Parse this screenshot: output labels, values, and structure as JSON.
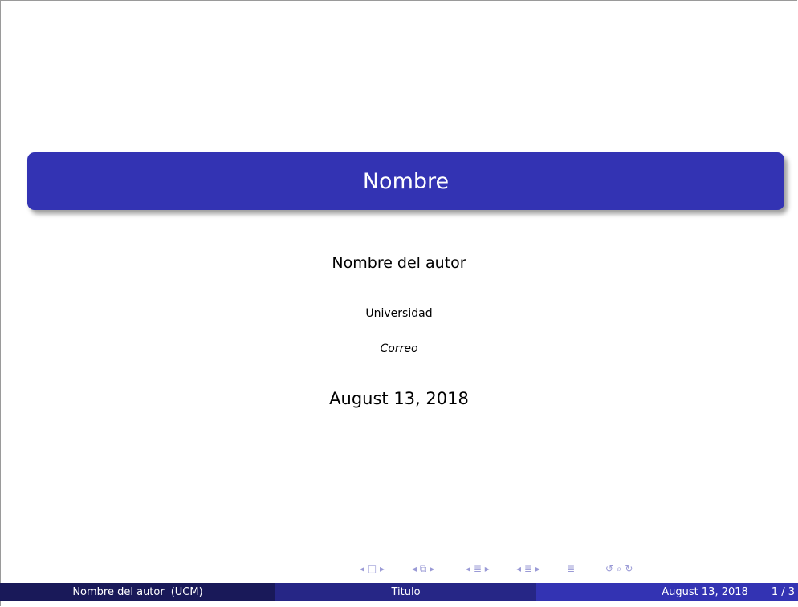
{
  "slide": {
    "title": "Nombre",
    "author": "Nombre del autor",
    "institute": "Universidad",
    "email": "Correo",
    "date": "August 13, 2018"
  },
  "footer": {
    "author": "Nombre del autor",
    "institute_short": "(UCM)",
    "title": "Titulo",
    "date": "August 13, 2018",
    "page": "1 / 3"
  },
  "colors": {
    "title_box": "#3333b3",
    "footer_left": "#191959",
    "footer_middle": "#262686",
    "footer_right": "#3333b3",
    "nav_symbols": "#9a9ad6"
  },
  "nav_icons": [
    "nav-frame-icon",
    "nav-subsection-icon",
    "nav-section-icon",
    "nav-section-icon",
    "nav-align-icon",
    "nav-search-icon"
  ]
}
